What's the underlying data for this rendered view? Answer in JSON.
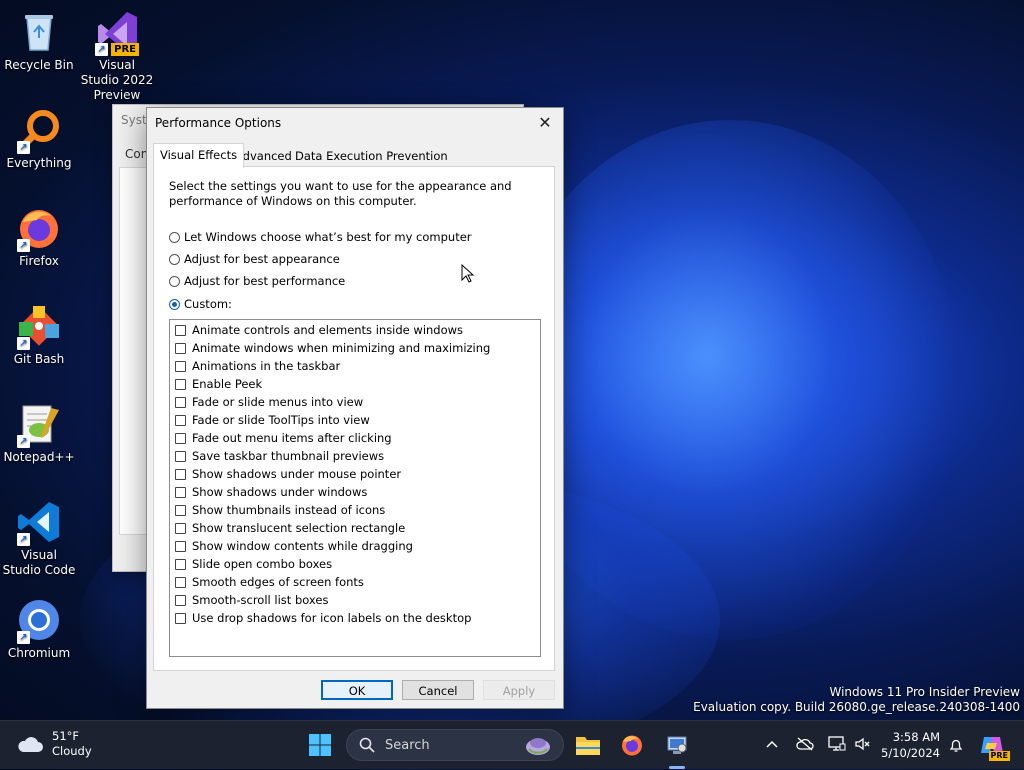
{
  "desktop": {
    "icons": [
      {
        "label": "Recycle Bin"
      },
      {
        "label": "Visual Studio 2022 Preview",
        "badge": "PRE"
      },
      {
        "label": "Everything"
      },
      {
        "label": "Firefox"
      },
      {
        "label": "Git Bash"
      },
      {
        "label": "Notepad++"
      },
      {
        "label": "Visual Studio Code"
      },
      {
        "label": "Chromium"
      }
    ],
    "shortcut_glyph": "↗"
  },
  "background_window": {
    "title": "Syste",
    "tab": "Com"
  },
  "dialog": {
    "title": "Performance Options",
    "close_glyph": "✕",
    "tabs": [
      {
        "label": "Visual Effects",
        "active": true
      },
      {
        "label": "Advanced",
        "active": false
      },
      {
        "label": "Data Execution Prevention",
        "active": false
      }
    ],
    "description": "Select the settings you want to use for the appearance and performance of Windows on this computer.",
    "radio_options": [
      {
        "label": "Let Windows choose what’s best for my computer",
        "selected": false
      },
      {
        "label": "Adjust for best appearance",
        "selected": false
      },
      {
        "label": "Adjust for best performance",
        "selected": false
      },
      {
        "label": "Custom:",
        "selected": true
      }
    ],
    "effects": [
      {
        "label": "Animate controls and elements inside windows",
        "checked": false
      },
      {
        "label": "Animate windows when minimizing and maximizing",
        "checked": false
      },
      {
        "label": "Animations in the taskbar",
        "checked": false
      },
      {
        "label": "Enable Peek",
        "checked": false
      },
      {
        "label": "Fade or slide menus into view",
        "checked": false
      },
      {
        "label": "Fade or slide ToolTips into view",
        "checked": false
      },
      {
        "label": "Fade out menu items after clicking",
        "checked": false
      },
      {
        "label": "Save taskbar thumbnail previews",
        "checked": false
      },
      {
        "label": "Show shadows under mouse pointer",
        "checked": false
      },
      {
        "label": "Show shadows under windows",
        "checked": false
      },
      {
        "label": "Show thumbnails instead of icons",
        "checked": false
      },
      {
        "label": "Show translucent selection rectangle",
        "checked": false
      },
      {
        "label": "Show window contents while dragging",
        "checked": false
      },
      {
        "label": "Slide open combo boxes",
        "checked": false
      },
      {
        "label": "Smooth edges of screen fonts",
        "checked": false
      },
      {
        "label": "Smooth-scroll list boxes",
        "checked": false
      },
      {
        "label": "Use drop shadows for icon labels on the desktop",
        "checked": false
      }
    ],
    "buttons": {
      "ok": "OK",
      "cancel": "Cancel",
      "apply": "Apply"
    }
  },
  "watermark": {
    "line1": "Windows 11 Pro Insider Preview",
    "line2": "Evaluation copy. Build 26080.ge_release.240308-1400"
  },
  "taskbar": {
    "weather_temp": "51°F",
    "weather_desc": "Cloudy",
    "search_label": "Search",
    "clock_time": "3:58 AM",
    "clock_date": "5/10/2024",
    "copilot_badge": "PRE"
  },
  "colors": {
    "accent": "#0067c0",
    "radio_selected": "#1a5fb4",
    "taskbar": "#1c2230"
  }
}
